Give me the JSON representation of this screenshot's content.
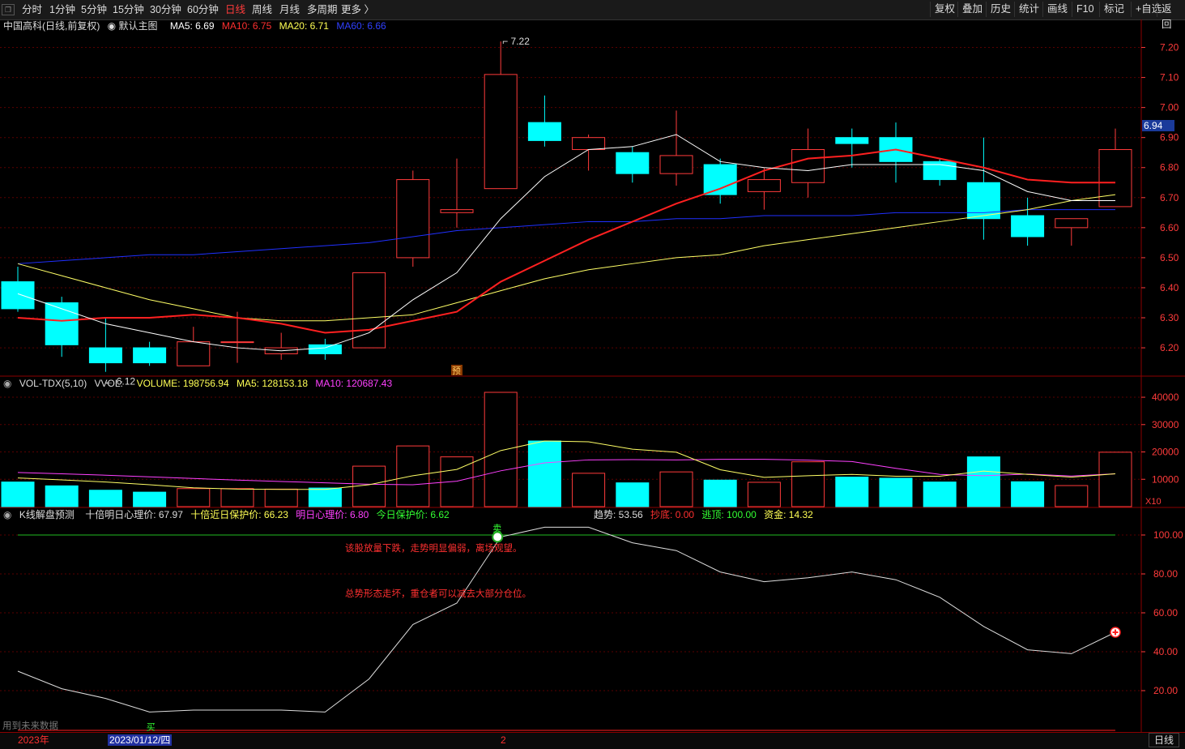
{
  "toolbar": {
    "periods": [
      {
        "label": "分时",
        "active": false
      },
      {
        "label": "1分钟",
        "active": false
      },
      {
        "label": "5分钟",
        "active": false
      },
      {
        "label": "15分钟",
        "active": false
      },
      {
        "label": "30分钟",
        "active": false
      },
      {
        "label": "60分钟",
        "active": false
      },
      {
        "label": "日线",
        "active": true
      },
      {
        "label": "周线",
        "active": false
      },
      {
        "label": "月线",
        "active": false
      },
      {
        "label": "多周期",
        "active": false
      },
      {
        "label": "更多 〉",
        "active": false
      }
    ],
    "tools": [
      "复权",
      "叠加",
      "历史",
      "统计",
      "画线",
      "F10",
      "标记",
      "+自选",
      "返回"
    ]
  },
  "main_panel": {
    "stock": "中国高科(日线,前复权)",
    "template": "默认主图",
    "ma5": "MA5: 6.69",
    "ma10": "MA10: 6.75",
    "ma20": "MA20: 6.71",
    "ma60": "MA60: 6.66",
    "price_tag": "6.94",
    "high_label": "7.22",
    "low_label": "6.12",
    "pre_label": "预"
  },
  "vol_panel": {
    "name": "VOL-TDX(5,10)",
    "vvol": "VVOL: -",
    "volume": "VOLUME: 198756.94",
    "ma5": "MA5: 128153.18",
    "ma10": "MA10: 120687.43",
    "unit": "X10"
  },
  "ind_panel": {
    "name": "K线解盘预测",
    "a": "十倍明日心理价: 67.97",
    "b": "十倍近日保护价: 66.23",
    "c": "明日心理价: 6.80",
    "d": "今日保护价: 6.62",
    "trend": "趋势: 53.56",
    "bottom": "抄底: 0.00",
    "top": "逃顶: 100.00",
    "fund": "资金: 14.32",
    "msg1": "该股放量下跌，走势明显偏弱，离场观望。",
    "msg2": "总势形态走坏，重仓者可以减去大部分仓位。",
    "sell": "卖",
    "buy": "买",
    "future": "用到未来数据"
  },
  "bottom": {
    "year": "2023年",
    "date": "2023/01/12/四",
    "mark": "2",
    "period": "日线"
  },
  "colors": {
    "up": "#ff3b3b",
    "down": "#00ffff",
    "ma5": "#ffffff",
    "ma10": "#ff2020",
    "ma20": "#ffff66",
    "ma60": "#2030ff",
    "axis": "#ff3b3b"
  },
  "chart_data": [
    {
      "type": "candlestick",
      "ylim": [
        6.13,
        7.25
      ],
      "yticks": [
        6.2,
        6.3,
        6.4,
        6.5,
        6.6,
        6.7,
        6.8,
        6.9,
        7.0,
        7.1,
        7.2
      ],
      "candles": [
        {
          "o": 6.42,
          "h": 6.47,
          "l": 6.32,
          "c": 6.33
        },
        {
          "o": 6.35,
          "h": 6.37,
          "l": 6.17,
          "c": 6.21
        },
        {
          "o": 6.2,
          "h": 6.3,
          "l": 6.12,
          "c": 6.15
        },
        {
          "o": 6.2,
          "h": 6.22,
          "l": 6.14,
          "c": 6.15
        },
        {
          "o": 6.14,
          "h": 6.27,
          "l": 6.14,
          "c": 6.22
        },
        {
          "o": 6.22,
          "h": 6.32,
          "l": 6.15,
          "c": 6.22
        },
        {
          "o": 6.18,
          "h": 6.25,
          "l": 6.16,
          "c": 6.2
        },
        {
          "o": 6.21,
          "h": 6.23,
          "l": 6.16,
          "c": 6.18
        },
        {
          "o": 6.2,
          "h": 6.45,
          "l": 6.2,
          "c": 6.45
        },
        {
          "o": 6.5,
          "h": 6.79,
          "l": 6.47,
          "c": 6.76
        },
        {
          "o": 6.65,
          "h": 6.83,
          "l": 6.6,
          "c": 6.66
        },
        {
          "o": 6.73,
          "h": 7.22,
          "l": 6.73,
          "c": 7.11
        },
        {
          "o": 6.95,
          "h": 7.04,
          "l": 6.87,
          "c": 6.89
        },
        {
          "o": 6.86,
          "h": 6.91,
          "l": 6.79,
          "c": 6.9
        },
        {
          "o": 6.85,
          "h": 6.87,
          "l": 6.75,
          "c": 6.78
        },
        {
          "o": 6.78,
          "h": 6.99,
          "l": 6.74,
          "c": 6.84
        },
        {
          "o": 6.81,
          "h": 6.83,
          "l": 6.68,
          "c": 6.71
        },
        {
          "o": 6.72,
          "h": 6.8,
          "l": 6.66,
          "c": 6.76
        },
        {
          "o": 6.75,
          "h": 6.93,
          "l": 6.7,
          "c": 6.86
        },
        {
          "o": 6.9,
          "h": 6.93,
          "l": 6.8,
          "c": 6.88
        },
        {
          "o": 6.9,
          "h": 6.95,
          "l": 6.75,
          "c": 6.82
        },
        {
          "o": 6.82,
          "h": 6.83,
          "l": 6.74,
          "c": 6.76
        },
        {
          "o": 6.75,
          "h": 6.9,
          "l": 6.56,
          "c": 6.63
        },
        {
          "o": 6.64,
          "h": 6.7,
          "l": 6.54,
          "c": 6.57
        },
        {
          "o": 6.6,
          "h": 6.63,
          "l": 6.54,
          "c": 6.63
        },
        {
          "o": 6.67,
          "h": 6.93,
          "l": 6.67,
          "c": 6.86
        }
      ],
      "ma5": [
        6.38,
        6.33,
        6.28,
        6.25,
        6.22,
        6.2,
        6.19,
        6.2,
        6.25,
        6.36,
        6.45,
        6.63,
        6.77,
        6.86,
        6.87,
        6.91,
        6.82,
        6.8,
        6.79,
        6.81,
        6.81,
        6.81,
        6.79,
        6.72,
        6.69,
        6.69
      ],
      "ma10": [
        6.3,
        6.29,
        6.3,
        6.3,
        6.31,
        6.3,
        6.28,
        6.25,
        6.26,
        6.29,
        6.32,
        6.42,
        6.49,
        6.56,
        6.62,
        6.68,
        6.73,
        6.79,
        6.83,
        6.84,
        6.86,
        6.83,
        6.8,
        6.76,
        6.75,
        6.75
      ],
      "ma20": [
        6.48,
        6.44,
        6.4,
        6.36,
        6.33,
        6.3,
        6.29,
        6.29,
        6.3,
        6.31,
        6.35,
        6.39,
        6.43,
        6.46,
        6.48,
        6.5,
        6.51,
        6.54,
        6.56,
        6.58,
        6.6,
        6.62,
        6.64,
        6.66,
        6.69,
        6.71
      ],
      "ma60": [
        6.48,
        6.49,
        6.5,
        6.51,
        6.51,
        6.52,
        6.53,
        6.54,
        6.55,
        6.57,
        6.59,
        6.6,
        6.61,
        6.62,
        6.62,
        6.63,
        6.63,
        6.64,
        6.64,
        6.64,
        6.65,
        6.65,
        6.65,
        6.66,
        6.66,
        6.66
      ]
    },
    {
      "type": "bar",
      "ylim": [
        0,
        41500
      ],
      "yticks": [
        10000,
        20000,
        30000,
        40000
      ],
      "values": [
        9000,
        7600,
        6000,
        5300,
        6600,
        6600,
        6400,
        6800,
        14800,
        22200,
        18200,
        41800,
        24000,
        12200,
        8700,
        12700,
        9700,
        8900,
        16400,
        10800,
        10400,
        9000,
        18200,
        9100,
        7700,
        19900
      ],
      "ma5": [
        10500,
        9800,
        9000,
        8000,
        6900,
        6400,
        6300,
        6300,
        8000,
        11300,
        13600,
        20500,
        24000,
        23700,
        21000,
        19900,
        13500,
        10700,
        11300,
        11800,
        11100,
        11100,
        13000,
        11800,
        10800,
        12000
      ],
      "ma10": [
        12500,
        12000,
        11500,
        10900,
        10300,
        9700,
        9200,
        8700,
        8200,
        8000,
        9300,
        13100,
        16000,
        17100,
        17200,
        17100,
        17300,
        17300,
        17000,
        16500,
        14000,
        11800,
        11300,
        11900,
        11200,
        12000
      ]
    },
    {
      "type": "line",
      "ylim": [
        0,
        110
      ],
      "yticks": [
        20,
        40,
        60,
        80,
        100
      ],
      "values": [
        30,
        21,
        16,
        9,
        10,
        10,
        10,
        9,
        26,
        54,
        65,
        99,
        104,
        104,
        96,
        92,
        81,
        76,
        78,
        81,
        77,
        68,
        53,
        41,
        39,
        50
      ],
      "ref_line": 100
    }
  ]
}
